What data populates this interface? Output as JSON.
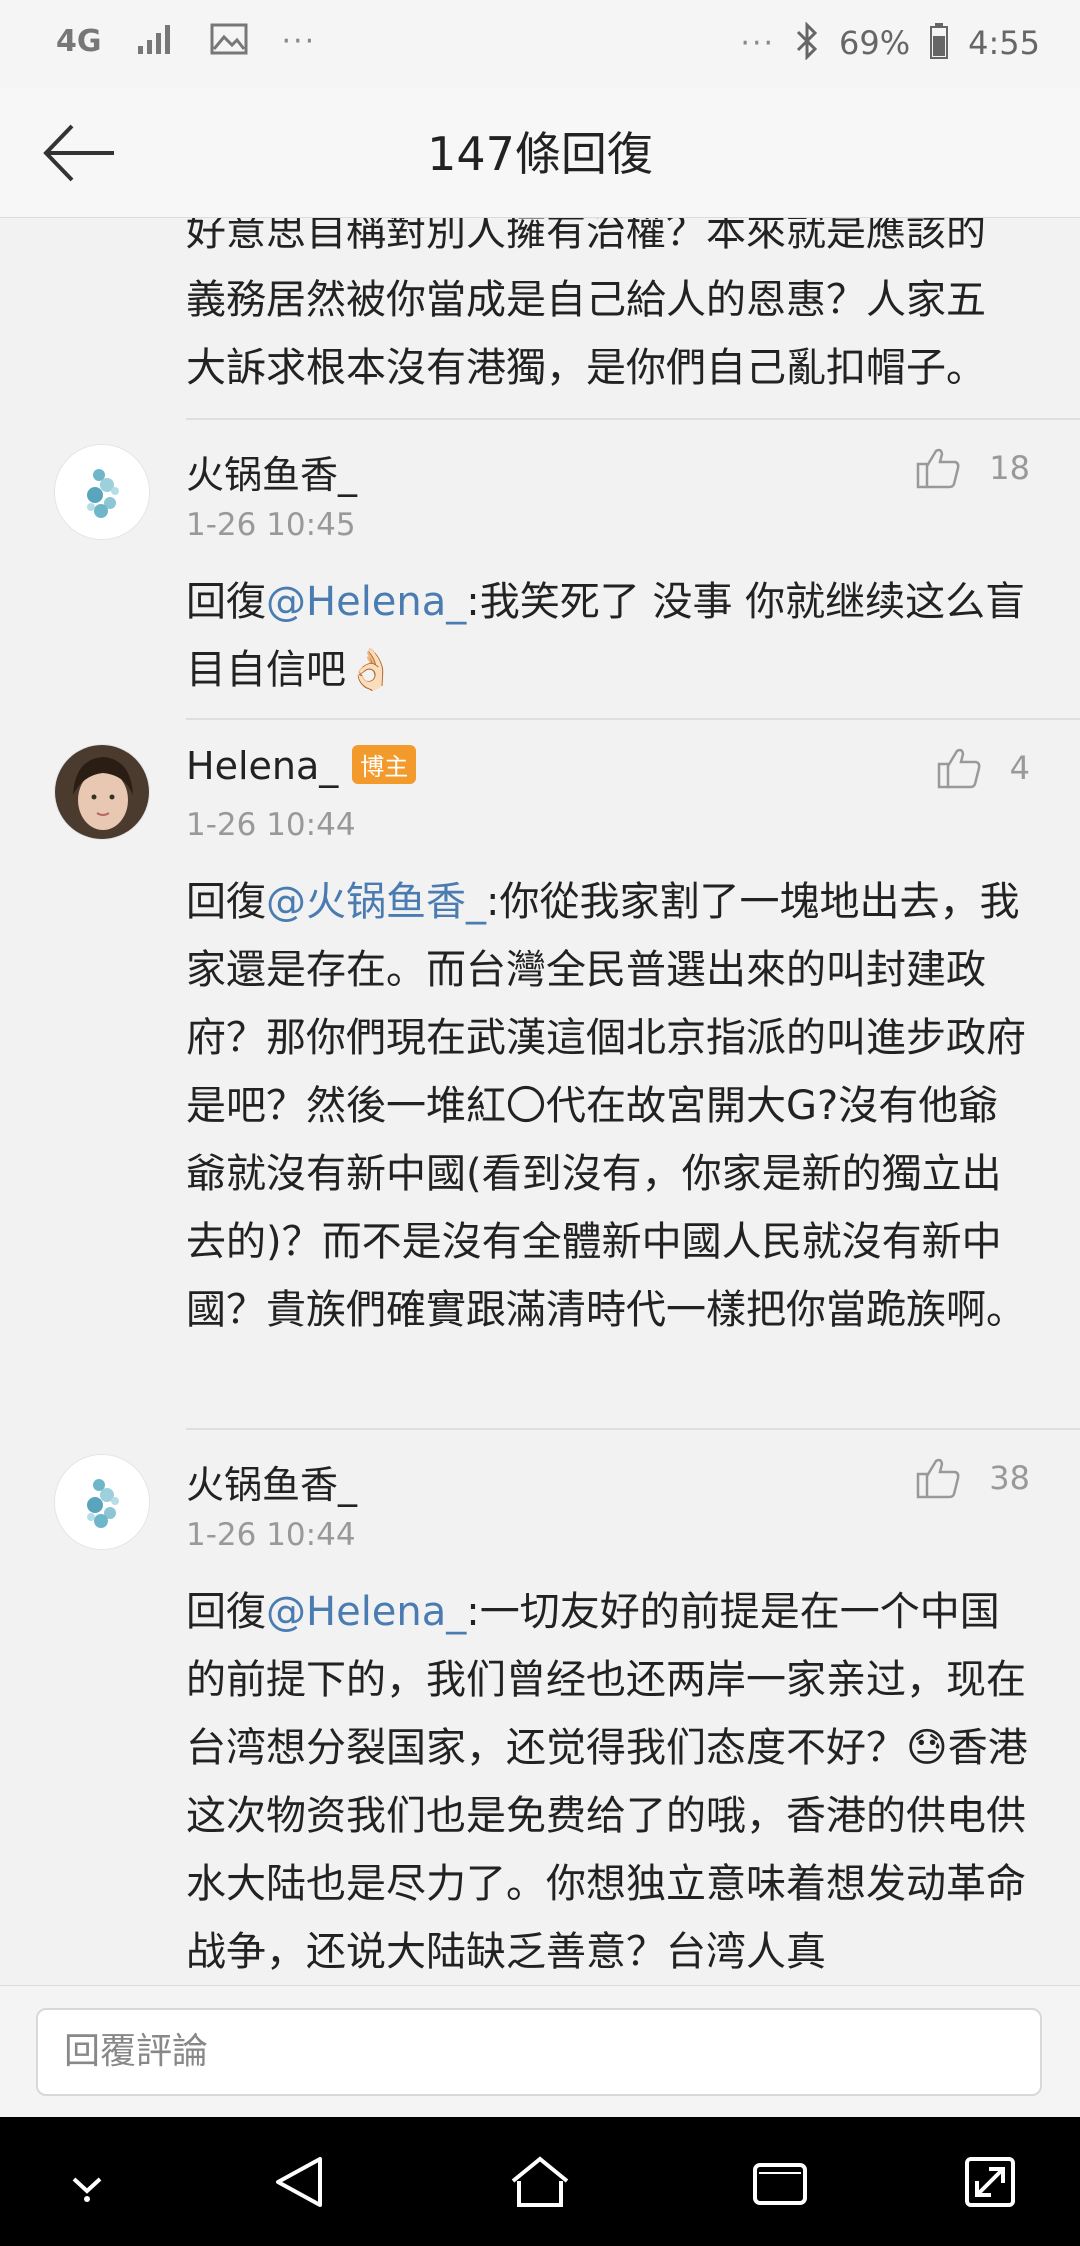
{
  "status_bar": {
    "network": "4G",
    "dots_left": "···",
    "dots_right": "···",
    "battery": "69%",
    "time": "4:55"
  },
  "header": {
    "title": "147條回復"
  },
  "partial_comment": {
    "lines": [
      "好意思自稱對別人擁有治權？本來就是應該的",
      "義務居然被你當成是自己給人的恩惠？人家五",
      "大訴求根本沒有港獨，是你們自己亂扣帽子。"
    ]
  },
  "comments": [
    {
      "username": "火锅鱼香_",
      "badge": "",
      "timestamp": "1-26 10:45",
      "likes": "18",
      "reply_prefix": "回復",
      "mention": "@Helena_",
      "text": ":我笑死了 没事 你就继续这么盲目自信吧👌🏻"
    },
    {
      "username": "Helena_",
      "badge": "博主",
      "timestamp": "1-26 10:44",
      "likes": "4",
      "reply_prefix": "回復",
      "mention": "@火锅鱼香_",
      "text": ":你從我家割了一塊地出去，我家還是存在。而台灣全民普選出來的叫封建政府？那你們現在武漢這個北京指派的叫進步政府是吧？然後一堆紅〇代在故宮開大G?沒有他爺爺就沒有新中國(看到沒有，你家是新的獨立出去的)？而不是沒有全體新中國人民就沒有新中國？貴族們確實跟滿清時代一樣把你當跪族啊。"
    },
    {
      "username": "火锅鱼香_",
      "badge": "",
      "timestamp": "1-26 10:44",
      "likes": "38",
      "reply_prefix": "回復",
      "mention": "@Helena_",
      "text": ":一切友好的前提是在一个中国的前提下的，我们曾经也还两岸一家亲过，现在台湾想分裂国家，还觉得我们态度不好？😓香港这次物资我们也是免费给了的哦，香港的供电供水大陆也是尽力了。你想独立意味着想发动革命战争，还说大陆缺乏善意？台湾人真"
    }
  ],
  "reply_bar": {
    "placeholder": "回覆評論"
  },
  "colors": {
    "mention": "#4a7cb2",
    "badge": "#f39a2c"
  }
}
